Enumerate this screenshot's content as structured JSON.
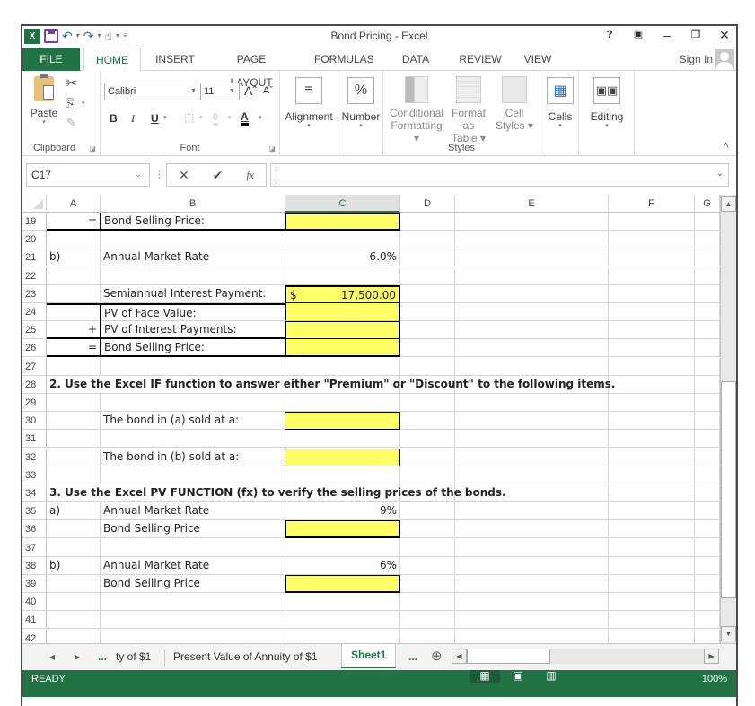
{
  "window": {
    "title": "Bond Pricing - Excel",
    "help": "?",
    "ribbon_display": "▣",
    "minimize": "–",
    "restore": "❐",
    "close": "✕"
  },
  "qat": {
    "app_icon": "X",
    "save": "💾",
    "undo": "↶",
    "redo": "↷",
    "touch": "☝",
    "more": "≡",
    "caret": "▾"
  },
  "tabs": [
    {
      "label": "FILE"
    },
    {
      "label": "HOME"
    },
    {
      "label": "INSERT"
    },
    {
      "label": "PAGE LAYOUT"
    },
    {
      "label": "FORMULAS"
    },
    {
      "label": "DATA"
    },
    {
      "label": "REVIEW"
    },
    {
      "label": "VIEW"
    }
  ],
  "signin": "Sign In",
  "ribbon": {
    "clipboard": {
      "label": "Clipboard",
      "paste": "Paste",
      "cut": "✂",
      "copy": "⎘",
      "format_painter": "✎"
    },
    "font": {
      "label": "Font",
      "font_name": "Calibri",
      "font_size": "11",
      "grow": "Aˆ",
      "shrink": "Aˇ",
      "bold": "B",
      "italic": "I",
      "underline": "U",
      "borders": "⬚",
      "fill": "◊",
      "font_color": "A"
    },
    "alignment": {
      "label": "Alignment",
      "icon": "≡"
    },
    "number": {
      "label": "Number",
      "icon": "%"
    },
    "styles": {
      "label": "Styles",
      "conditional": [
        "Conditional",
        "Formatting"
      ],
      "format_table": [
        "Format as",
        "Table"
      ],
      "cell_styles": [
        "Cell",
        "Styles"
      ]
    },
    "cells": {
      "label": "Cells",
      "icon": "▦"
    },
    "editing": {
      "label": "Editing",
      "icon": "🔍"
    },
    "collapse": "˄"
  },
  "formula_bar": {
    "name_box": "C17",
    "cancel": "✕",
    "enter": "✔",
    "fx": "fx",
    "value": ""
  },
  "columns": [
    "A",
    "B",
    "C",
    "D",
    "E",
    "F",
    "G"
  ],
  "selected_column": "C",
  "rows": [
    {
      "n": "19",
      "A": "=",
      "B": "Bond Selling Price:",
      "C": ""
    },
    {
      "n": "20"
    },
    {
      "n": "21",
      "A": "b)",
      "B": "Annual Market Rate",
      "C": "6.0%"
    },
    {
      "n": "22"
    },
    {
      "n": "23",
      "B": "Semiannual Interest Payment:",
      "C_symbol": "$",
      "C": "17,500.00"
    },
    {
      "n": "24",
      "B": "PV of Face Value:",
      "C": ""
    },
    {
      "n": "25",
      "A": "+",
      "B": "PV of Interest Payments:",
      "C": ""
    },
    {
      "n": "26",
      "A": "=",
      "B": "Bond Selling Price:",
      "C": ""
    },
    {
      "n": "27"
    },
    {
      "n": "28",
      "A": "2. Use the Excel IF function to answer either \"Premium\" or \"Discount\" to the following items."
    },
    {
      "n": "29"
    },
    {
      "n": "30",
      "B": "The bond in (a) sold at a:",
      "C": ""
    },
    {
      "n": "31"
    },
    {
      "n": "32",
      "B": "The bond in (b) sold at a:",
      "C": ""
    },
    {
      "n": "33"
    },
    {
      "n": "34",
      "A": "3.  Use the Excel PV FUNCTION (fx) to verify the selling prices of the bonds."
    },
    {
      "n": "35",
      "A": "a)",
      "B": "Annual Market Rate",
      "C": "9%"
    },
    {
      "n": "36",
      "B": "Bond Selling Price",
      "C": ""
    },
    {
      "n": "37"
    },
    {
      "n": "38",
      "A": "b)",
      "B": "Annual Market Rate",
      "C": "6%"
    },
    {
      "n": "39",
      "B": "Bond Selling Price",
      "C": ""
    },
    {
      "n": "40"
    },
    {
      "n": "41"
    },
    {
      "n": "42"
    }
  ],
  "sheet_tabs": {
    "prev": "◂",
    "next": "▸",
    "ellipsis_left": "...",
    "partial_tab": "ty of $1",
    "tab2": "Present Value of Annuity of $1",
    "active": "Sheet1",
    "ellipsis_right": "...",
    "add": "⊕"
  },
  "status": {
    "ready": "READY",
    "zoom": "100%"
  },
  "colors": {
    "excel_green": "#217346",
    "input_yellow": "#ffff66"
  }
}
